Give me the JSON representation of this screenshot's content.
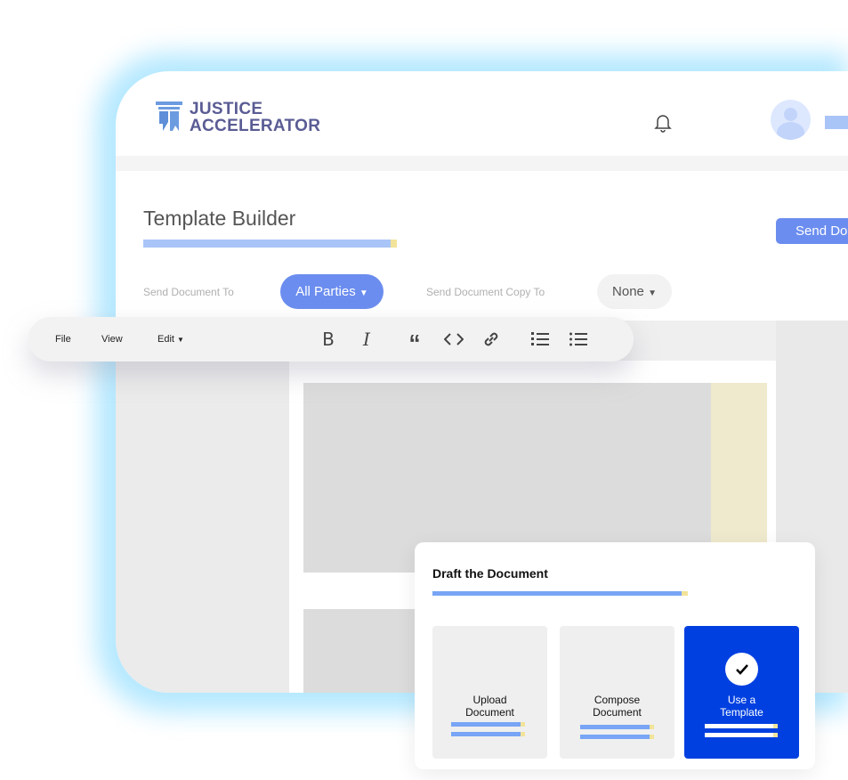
{
  "header": {
    "logo_line1": "JUSTICE",
    "logo_line2": "ACCELERATOR"
  },
  "page": {
    "title": "Template Builder",
    "send_button": "Send Do"
  },
  "recipients": {
    "send_to_label": "Send Document To",
    "send_to_value": "All Parties",
    "copy_to_label": "Send Document Copy To",
    "copy_to_value": "None"
  },
  "toolbar": {
    "menus": [
      "File",
      "View",
      "Edit"
    ],
    "tools": [
      "bold",
      "italic",
      "quote",
      "code",
      "link",
      "ordered-list",
      "unordered-list"
    ]
  },
  "draft": {
    "title": "Draft the Document",
    "options": [
      {
        "label1": "Upload",
        "label2": "Document",
        "selected": false
      },
      {
        "label1": "Compose",
        "label2": "Document",
        "selected": false
      },
      {
        "label1": "Use a",
        "label2": "Template",
        "selected": true
      }
    ]
  },
  "colors": {
    "brand": "#5a5c94",
    "accent": "#6b8def",
    "selected": "#0040e0",
    "glow": "#9fe0ff"
  }
}
